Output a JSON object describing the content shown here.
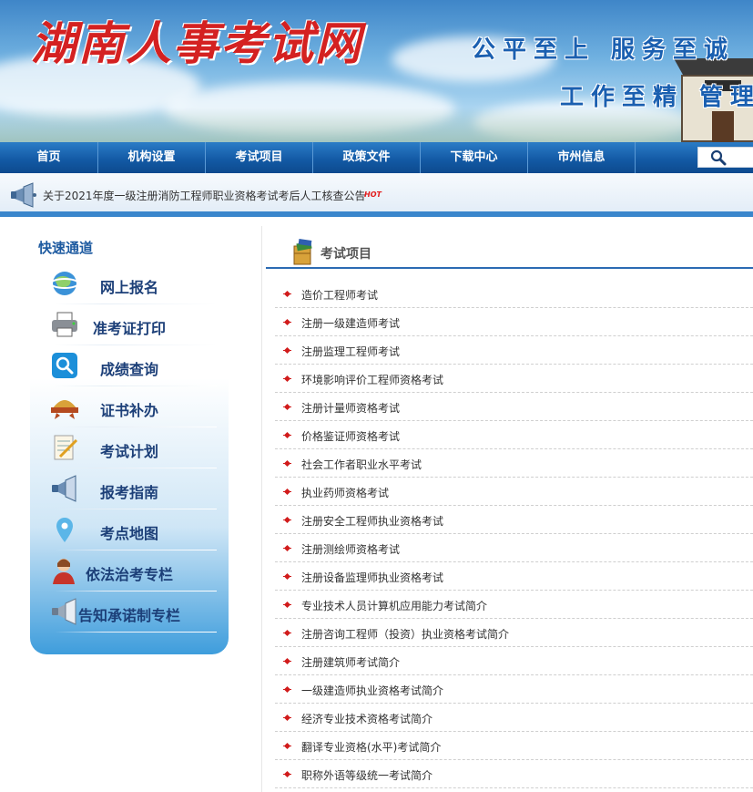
{
  "banner": {
    "title": "湖南人事考试网",
    "slogan_line1": "公平至上 服务至诚",
    "slogan_line2": "工作至精 管理至"
  },
  "nav": {
    "items": [
      "首页",
      "机构设置",
      "考试项目",
      "政策文件",
      "下载中心",
      "市州信息"
    ]
  },
  "ticker": {
    "text": "关于2021年度一级注册消防工程师职业资格考试考后人工核查公告",
    "hot": "HOT"
  },
  "sidebar": {
    "title": "快速通道",
    "items": [
      {
        "label": "网上报名",
        "icon": "globe-icon"
      },
      {
        "label": "准考证打印",
        "icon": "printer-icon"
      },
      {
        "label": "成绩查询",
        "icon": "magnifier-icon"
      },
      {
        "label": "证书补办",
        "icon": "certificate-icon"
      },
      {
        "label": "考试计划",
        "icon": "notepad-icon"
      },
      {
        "label": "报考指南",
        "icon": "megaphone-icon"
      },
      {
        "label": "考点地图",
        "icon": "map-pin-icon"
      },
      {
        "label": "依法治考专栏",
        "icon": "person-icon"
      },
      {
        "label": "告知承诺制专栏",
        "icon": "megaphone-icon"
      }
    ]
  },
  "main": {
    "title": "考试项目",
    "items": [
      "造价工程师考试",
      "注册一级建造师考试",
      "注册监理工程师考试",
      "环境影响评价工程师资格考试",
      "注册计量师资格考试",
      "价格鉴证师资格考试",
      "社会工作者职业水平考试",
      "执业药师资格考试",
      "注册安全工程师执业资格考试",
      "注册测绘师资格考试",
      "注册设备监理师执业资格考试",
      "专业技术人员计算机应用能力考试简介",
      "注册咨询工程师（投资）执业资格考试简介",
      "注册建筑师考试简介",
      "一级建造师执业资格考试简介",
      "经济专业技术资格考试简介",
      "翻译专业资格(水平)考试简介",
      "职称外语等级统一考试简介"
    ]
  },
  "colors": {
    "nav_bg": "#1258a3",
    "title_red": "#d42121",
    "slogan_blue": "#1a5fb0",
    "bullet_red": "#d11b1b",
    "sidebar_blue": "#3e9ddc"
  }
}
